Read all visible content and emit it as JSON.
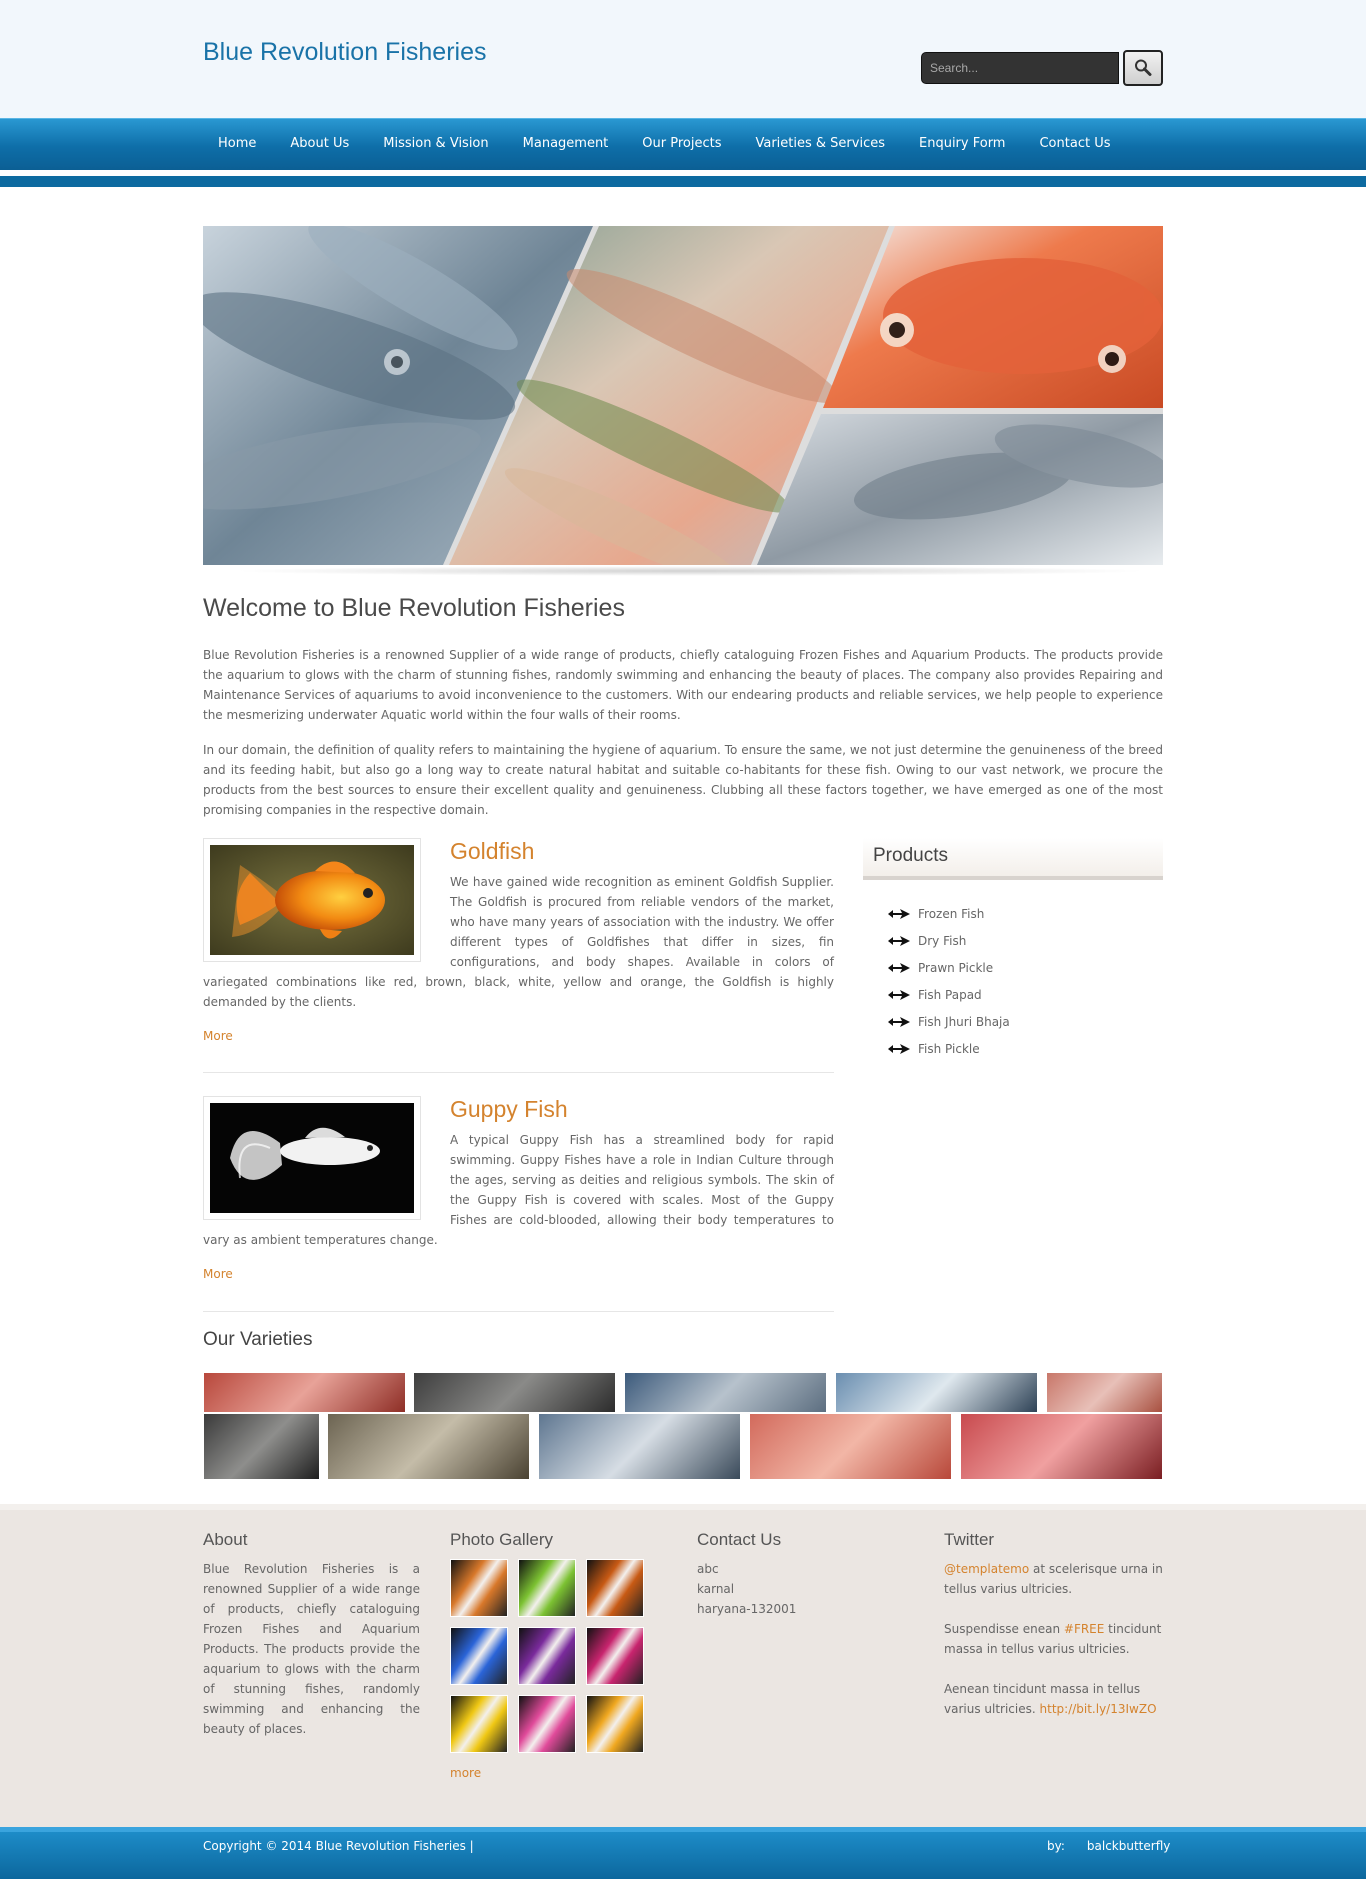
{
  "header": {
    "site_title": "Blue Revolution Fisheries",
    "search_placeholder": "Search...",
    "search_icon": "magnifier-icon"
  },
  "nav": {
    "items": [
      {
        "label": "Home"
      },
      {
        "label": "About Us"
      },
      {
        "label": "Mission & Vision"
      },
      {
        "label": "Management"
      },
      {
        "label": "Our Projects"
      },
      {
        "label": "Varieties & Services"
      },
      {
        "label": "Enquiry Form"
      },
      {
        "label": "Contact Us"
      }
    ]
  },
  "slider": {
    "slide_count": 4,
    "active_slide": 1
  },
  "welcome": {
    "title": "Welcome to Blue Revolution Fisheries",
    "paragraphs": [
      "Blue Revolution Fisheries is a renowned Supplier of a wide range of products, chiefly cataloguing Frozen Fishes and Aquarium Products. The products provide the aquarium to glows with the charm of stunning fishes, randomly swimming and enhancing the beauty of places. The company also provides Repairing and Maintenance Services of aquariums to avoid inconvenience to the customers. With our endearing products and reliable services, we help people to experience the mesmerizing underwater Aquatic world within the four walls of their rooms.",
      "In our domain, the definition of quality refers to maintaining the hygiene of aquarium. To ensure the same, we not just determine the genuineness of the breed and its feeding habit, but also go a long way to create natural habitat and suitable co-habitants for these fish. Owing to our vast network, we procure the products from the best sources to ensure their excellent quality and genuineness. Clubbing all these factors together, we have emerged as one of the most promising companies in the respective domain."
    ]
  },
  "articles": [
    {
      "title": "Goldfish",
      "text": "We have gained wide recognition as eminent Goldfish Supplier. The Goldfish is procured from reliable vendors of the market, who have many years of association with the industry. We offer different types of Goldfishes that differ in sizes, fin configurations, and body shapes. Available in colors of variegated combinations like red, brown, black, white, yellow and orange, the Goldfish is highly demanded by the clients.",
      "more": "More"
    },
    {
      "title": "Guppy Fish",
      "text": "A typical Guppy Fish has a streamlined body for rapid swimming. Guppy Fishes have a role in Indian Culture through the ages, serving as deities and religious symbols. The skin of the Guppy Fish is covered with scales. Most of the Guppy Fishes are cold-blooded, allowing their body temperatures to vary as ambient temperatures change.",
      "more": "More"
    }
  ],
  "sidebar": {
    "title": "Products",
    "bullet_icon": "fish-arrow-icon",
    "items": [
      {
        "label": "Frozen Fish"
      },
      {
        "label": "Dry Fish"
      },
      {
        "label": "Prawn Pickle"
      },
      {
        "label": "Fish Papad"
      },
      {
        "label": "Fish Jhuri Bhaja"
      },
      {
        "label": "Fish Pickle"
      }
    ]
  },
  "varieties": {
    "title": "Our Varieties"
  },
  "footer": {
    "about": {
      "title": "About",
      "text": "Blue Revolution Fisheries is a renowned Supplier of a wide range of products, chiefly cataloguing Frozen Fishes and Aquarium Products. The products provide the aquarium to glows with the charm of stunning fishes, randomly swimming and enhancing the beauty of places."
    },
    "gallery": {
      "title": "Photo Gallery",
      "more": "more",
      "thumb_colors": [
        "#d8782a",
        "#7cc232",
        "#c85a14",
        "#2a64d8",
        "#7a2a9c",
        "#c8246e",
        "#f0c814",
        "#e04a9a",
        "#f0a820"
      ]
    },
    "contact": {
      "title": "Contact Us",
      "lines": [
        "abc",
        "karnal",
        "haryana-132001"
      ]
    },
    "twitter": {
      "title": "Twitter",
      "tweet1_handle": "@templatemo",
      "tweet1_text": " at scelerisque urna in tellus varius ultricies.",
      "tweet2_pre": "Suspendisse enean ",
      "tweet2_tag": "#FREE",
      "tweet2_post": " tincidunt massa in tellus varius ultricies.",
      "tweet3_pre": "Aenean tincidunt massa in tellus varius ultricies. ",
      "tweet3_link": "http://bit.ly/13IwZO"
    }
  },
  "bottom": {
    "copyright": "Copyright © 2014 Blue Revolution Fisheries |",
    "by_label": "by:",
    "by_name": "balckbutterfly"
  },
  "colors": {
    "brand_blue": "#1a73a8",
    "nav_blue": "#0e6ea8",
    "accent_orange": "#d4832e",
    "footer_bg": "#ebe6e2"
  }
}
